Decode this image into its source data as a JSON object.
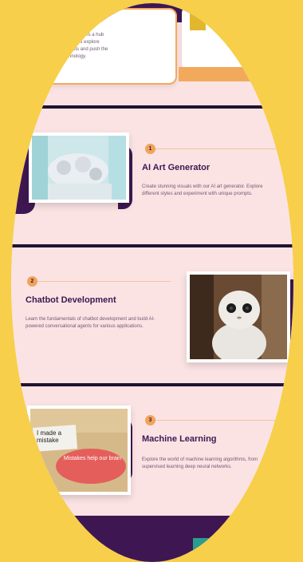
{
  "top_card": {
    "line1": "Weird Club is a hub",
    "line2": "with us to explore",
    "line3": "projects and push the",
    "line4": "technology."
  },
  "items": [
    {
      "number": "1",
      "title": "AI Art Generator",
      "desc": "Create stunning visuals with our AI art generator. Explore different styles and experiment with unique prompts.",
      "image": "ai-art-image"
    },
    {
      "number": "2",
      "title": "Chatbot Development",
      "desc": "Learn the fundamentals of chatbot development and build AI-powered conversational agents for various applications.",
      "image": "robot-image"
    },
    {
      "number": "3",
      "title": "Machine Learning",
      "desc": "Explore the world of machine learning algorithms, from supervised learning deep neural networks.",
      "image": "mistake-sign-image",
      "image_text_1": "I made a mistake",
      "image_text_2": "Mistakes help our brain"
    }
  ],
  "colors": {
    "background": "#f7cf4a",
    "panel": "#fbe3e4",
    "accent_purple": "#3e1752",
    "accent_orange": "#f0a458"
  }
}
